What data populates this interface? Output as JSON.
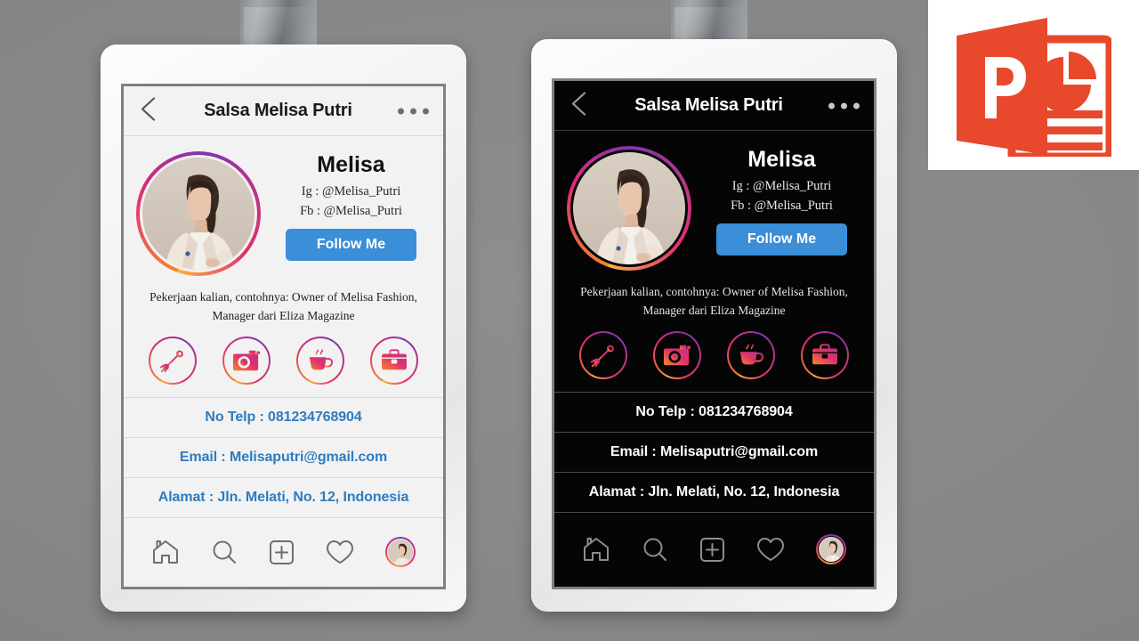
{
  "slide": {
    "background_color": "#858585"
  },
  "ppt_logo": {
    "letter": "P",
    "brand_color": "#E8492C",
    "panel_color": "#FFFFFF",
    "icon_name": "powerpoint-logo"
  },
  "cards": [
    {
      "theme": "light",
      "screen_bg": "#F2F2F2",
      "accent_color": "#2F7BBF",
      "header": {
        "back_icon": "chevron-left-icon",
        "title": "Salsa Melisa Putri",
        "menu_icon": "more-dots-icon"
      },
      "profile": {
        "name": "Melisa",
        "handles": [
          "Ig : @Melisa_Putri",
          "Fb : @Melisa_Putri"
        ],
        "follow_label": "Follow Me",
        "follow_color": "#3B8ED8",
        "avatar_name": "profile-photo"
      },
      "bio": "Pekerjaan kalian, contohnya: Owner of Melisa Fashion, Manager dari Eliza Magazine",
      "social_icons": [
        {
          "name": "diploma-icon",
          "label": "Diploma"
        },
        {
          "name": "camera-icon",
          "label": "Camera"
        },
        {
          "name": "coffee-cup-icon",
          "label": "Coffee"
        },
        {
          "name": "briefcase-icon",
          "label": "Briefcase"
        }
      ],
      "contacts": [
        {
          "name": "phone-row",
          "text": "No Telp : 081234768904"
        },
        {
          "name": "email-row",
          "text": "Email : Melisaputri@gmail.com"
        },
        {
          "name": "address-row",
          "text": "Alamat : Jln. Melati, No. 12, Indonesia"
        }
      ],
      "bottom_nav": [
        {
          "name": "nav-home-icon",
          "label": "Home"
        },
        {
          "name": "nav-search-icon",
          "label": "Search"
        },
        {
          "name": "nav-add-icon",
          "label": "Add"
        },
        {
          "name": "nav-activity-icon",
          "label": "Activity"
        },
        {
          "name": "nav-profile-avatar",
          "label": "Profile"
        }
      ]
    },
    {
      "theme": "dark",
      "screen_bg": "#050505",
      "accent_color": "#FFFFFF",
      "header": {
        "back_icon": "chevron-left-icon",
        "title": "Salsa Melisa Putri",
        "menu_icon": "more-dots-icon"
      },
      "profile": {
        "name": "Melisa",
        "handles": [
          "Ig : @Melisa_Putri",
          "Fb : @Melisa_Putri"
        ],
        "follow_label": "Follow Me",
        "follow_color": "#3B8ED8",
        "avatar_name": "profile-photo"
      },
      "bio": "Pekerjaan kalian, contohnya: Owner of Melisa Fashion, Manager dari Eliza Magazine",
      "social_icons": [
        {
          "name": "diploma-icon",
          "label": "Diploma"
        },
        {
          "name": "camera-icon",
          "label": "Camera"
        },
        {
          "name": "coffee-cup-icon",
          "label": "Coffee"
        },
        {
          "name": "briefcase-icon",
          "label": "Briefcase"
        }
      ],
      "contacts": [
        {
          "name": "phone-row",
          "text": "No Telp : 081234768904"
        },
        {
          "name": "email-row",
          "text": "Email : Melisaputri@gmail.com"
        },
        {
          "name": "address-row",
          "text": "Alamat : Jln. Melati, No. 12, Indonesia"
        }
      ],
      "bottom_nav": [
        {
          "name": "nav-home-icon",
          "label": "Home"
        },
        {
          "name": "nav-search-icon",
          "label": "Search"
        },
        {
          "name": "nav-add-icon",
          "label": "Add"
        },
        {
          "name": "nav-activity-icon",
          "label": "Activity"
        },
        {
          "name": "nav-profile-avatar",
          "label": "Profile"
        }
      ]
    }
  ]
}
